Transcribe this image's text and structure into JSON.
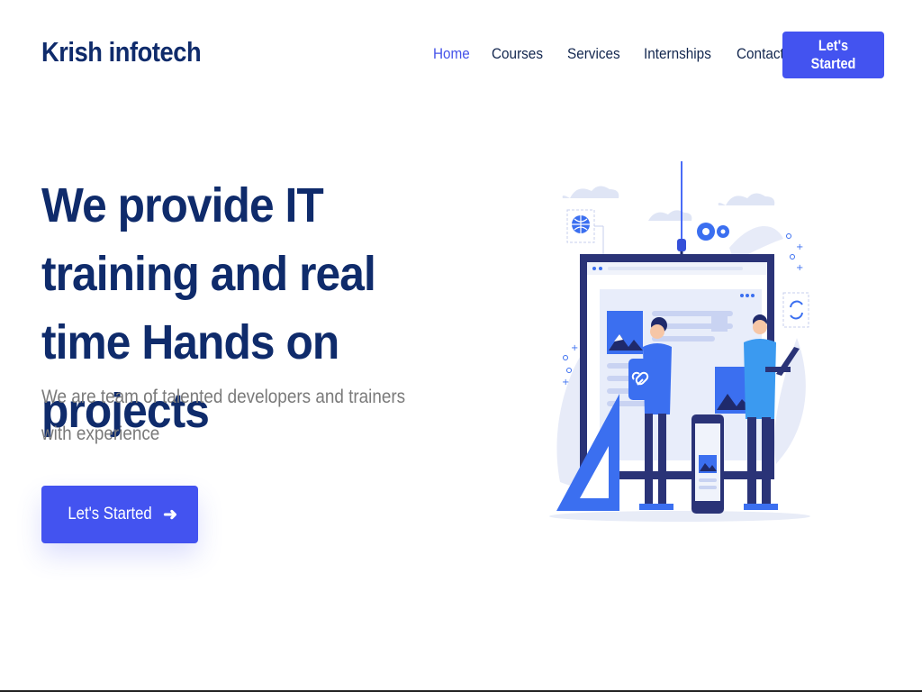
{
  "header": {
    "logo": "Krish infotech",
    "nav": [
      {
        "label": "Home",
        "active": true
      },
      {
        "label": "Courses"
      },
      {
        "label": "Services"
      },
      {
        "label": "Internships"
      },
      {
        "label": "Contact us"
      }
    ],
    "cta_label": "Let's Started"
  },
  "hero": {
    "title": "We provide IT training and real time Hands on projects",
    "subtitle": "We are team of talented developers and trainers with experience",
    "cta_label": "Let's Started",
    "cta_icon": "arrow-right-icon"
  },
  "colors": {
    "brand": "#4353f0",
    "heading": "#0f2b6b",
    "nav_text": "#13274f",
    "nav_active": "#4453e9",
    "body_text": "#7a7a7a"
  }
}
